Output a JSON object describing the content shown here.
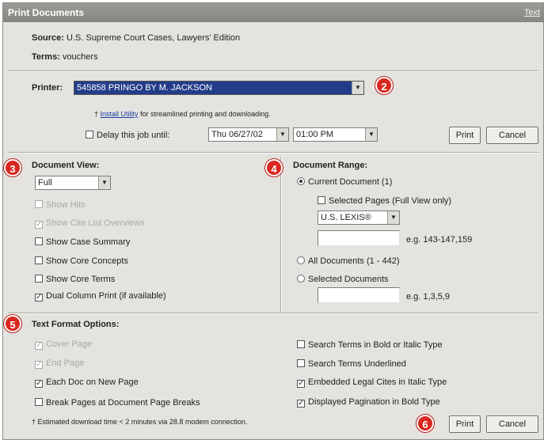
{
  "window": {
    "title": "Print Documents",
    "close_label": "Text"
  },
  "source": {
    "label": "Source:",
    "value": "U.S. Supreme Court Cases, Lawyers' Edition"
  },
  "terms": {
    "label": "Terms:",
    "value": "vouchers"
  },
  "printer": {
    "label": "Printer:",
    "selected": "545858 PRINGO BY M. JACKSON",
    "hint_prefix": "†",
    "hint_link": "Install Utility",
    "hint_suffix": "for streamlined printing and downloading."
  },
  "delay": {
    "label": "Delay this job until:",
    "date": "Thu 06/27/02",
    "time": "01:00 PM"
  },
  "top_buttons": {
    "print": "Print",
    "cancel": "Cancel"
  },
  "document_view": {
    "heading": "Document View:",
    "selected": "Full",
    "options": [
      {
        "label": "Show Hits",
        "checked": false,
        "disabled": true
      },
      {
        "label": "Show Cite List Overviews",
        "checked": true,
        "disabled": true
      },
      {
        "label": "Show Case Summary",
        "checked": false,
        "disabled": false
      },
      {
        "label": "Show Core Concepts",
        "checked": false,
        "disabled": false
      },
      {
        "label": "Show Core Terms",
        "checked": false,
        "disabled": false
      },
      {
        "label": "Dual Column Print (if available)",
        "checked": true,
        "disabled": false
      }
    ]
  },
  "document_range": {
    "heading": "Document Range:",
    "current_document": "Current Document (1)",
    "selected_pages": "Selected Pages (Full View only)",
    "citation_format": "U.S. LEXIS®",
    "pages_example": "e.g. 143-147,159",
    "all_documents": "All Documents (1 - 442)",
    "selected_documents": "Selected Documents",
    "documents_example": "e.g. 1,3,5,9"
  },
  "text_format": {
    "heading": "Text Format Options:",
    "left": [
      {
        "label": "Cover Page",
        "checked": true,
        "disabled": true
      },
      {
        "label": "End Page",
        "checked": true,
        "disabled": true
      },
      {
        "label": "Each Doc on New Page",
        "checked": true,
        "disabled": false
      },
      {
        "label": "Break Pages at Document Page Breaks",
        "checked": false,
        "disabled": false
      }
    ],
    "right": [
      {
        "label": "Search Terms in Bold or Italic Type",
        "checked": false,
        "disabled": false
      },
      {
        "label": "Search Terms Underlined",
        "checked": false,
        "disabled": false
      },
      {
        "label": "Embedded Legal Cites in Italic Type",
        "checked": true,
        "disabled": false
      },
      {
        "label": "Displayed Pagination in Bold Type",
        "checked": true,
        "disabled": false
      }
    ]
  },
  "footer": {
    "note": "† Estimated download time < 2 minutes via 28.8 modem connection.",
    "print": "Print",
    "cancel": "Cancel"
  },
  "callouts": [
    "2",
    "3",
    "4",
    "5",
    "6"
  ],
  "colors": {
    "callout": "#d9281f",
    "title_bar": "#8f8e8a",
    "printer_select": "#233d8a"
  }
}
